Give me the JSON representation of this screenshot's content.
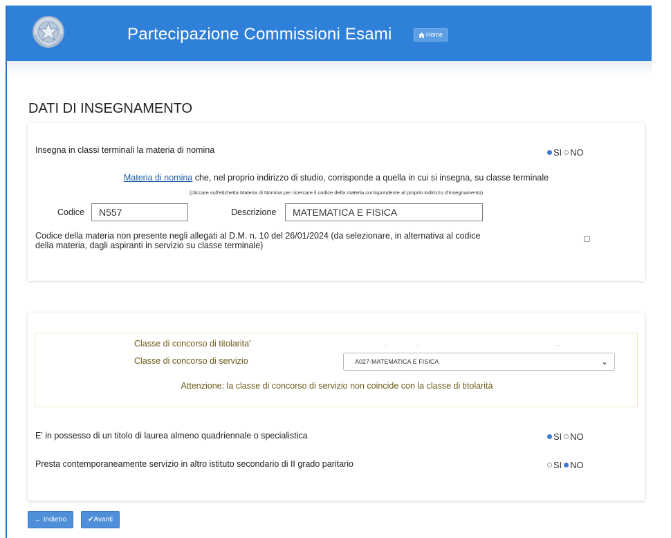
{
  "header": {
    "app_title": "Partecipazione Commissioni Esami",
    "home_label": "Home",
    "home_icon": "home-icon",
    "emblem_icon": "repubblica-emblem-icon",
    "bg_color": "#2f80d8"
  },
  "page": {
    "title": "DATI DI INSEGNAMENTO"
  },
  "section1": {
    "question_terminali": "Insegna in classi terminali la materia di nomina",
    "terminali_options": [
      {
        "label": "SI",
        "selected": true
      },
      {
        "label": "NO",
        "selected": false
      }
    ],
    "materia_link": "Materia di nomina",
    "materia_text": " che, nel proprio indirizzo di studio, corrisponde a quella in cui si insegna, su classe terminale",
    "hint": "(cliccare sull'etichetta Materia di Nomina per ricercare il codice della materia corrispondente al proprio indirizzo d'insegnamento)",
    "codice_label": "Codice",
    "codice_value": "N557",
    "descrizione_label": "Descrizione",
    "descrizione_value": "MATEMATICA E FISICA",
    "note_line1": "Codice della materia non presente negli allegati al D.M. n. 10 del 26/01/2024 (da selezionare, in alternativa al codice",
    "note_line2": "della materia, dagli aspiranti in servizio su classe terminale)",
    "note_checked": false
  },
  "section2": {
    "titolarita_label": "Classe di concorso di titolarita'",
    "servizio_label": "Classe di concorso di servizio",
    "servizio_value": "A027-MATEMATICA E FISICA",
    "warning": "Attenzione: la classe di concorso di servizio non coincide con la classe di titolarità",
    "question_laurea": "E' in possesso di un titolo di laurea almeno quadriennale o specialistica",
    "laurea_options": [
      {
        "label": "SI",
        "selected": true
      },
      {
        "label": "NO",
        "selected": false
      }
    ],
    "question_paritario": "Presta contemporaneamente servizio in altro istituto secondario di II grado paritario",
    "paritario_options": [
      {
        "label": "SI",
        "selected": false
      },
      {
        "label": "NO",
        "selected": true
      }
    ]
  },
  "footer": {
    "back_label": "Indietro",
    "back_icon": "arrow-left-icon",
    "next_label": "Avanti",
    "next_icon": "check-icon"
  }
}
